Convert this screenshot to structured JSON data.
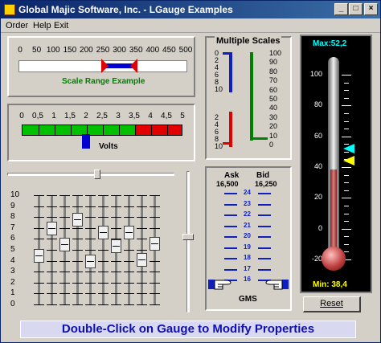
{
  "window": {
    "title": "Global Majic Software, Inc.  -  LGauge Examples"
  },
  "menu": {
    "items": [
      "Order",
      "Help",
      "Exit"
    ]
  },
  "scale_range": {
    "labels": [
      "0",
      "50",
      "100",
      "150",
      "200",
      "250",
      "300",
      "350",
      "400",
      "450",
      "500"
    ],
    "caption": "Scale Range Example",
    "range_low": 250,
    "range_high": 350
  },
  "volts": {
    "labels": [
      "0",
      "0,5",
      "1",
      "1,5",
      "2",
      "2,5",
      "3",
      "3,5",
      "4",
      "4,5",
      "5"
    ],
    "caption": "Volts",
    "value": 2,
    "green_max": 3.5,
    "colors": {
      "green": "#00c000",
      "red": "#e00000",
      "pointer": "#0000d0"
    }
  },
  "multiple_scales": {
    "title": "Multiple Scales",
    "left_top": [
      "0",
      "2",
      "4",
      "6",
      "8",
      "10"
    ],
    "left_bottom": [
      "2",
      "4",
      "6",
      "8",
      "10"
    ],
    "right": [
      "100",
      "90",
      "80",
      "70",
      "60",
      "50",
      "40",
      "30",
      "20",
      "10",
      "0"
    ]
  },
  "ask_bid": {
    "ask_label": "Ask",
    "bid_label": "Bid",
    "ask_value": "16,500",
    "bid_value": "16,250",
    "scale": [
      "24",
      "23",
      "22",
      "21",
      "20",
      "19",
      "18",
      "17",
      "16"
    ],
    "footer": "GMS",
    "colors": {
      "ask": "#008000",
      "bid": "#e00000"
    }
  },
  "faders": {
    "scale": [
      "10",
      "9",
      "8",
      "7",
      "6",
      "5",
      "4",
      "3",
      "2",
      "1",
      "0"
    ],
    "values": [
      4.5,
      7.0,
      5.5,
      7.8,
      4.0,
      6.6,
      5.4,
      6.6,
      4.1,
      5.6
    ]
  },
  "thermometer": {
    "max_label": "Max:52,2",
    "min_label": "Min: 38,4",
    "scale": [
      "100",
      "80",
      "60",
      "40",
      "20",
      "0",
      "-20"
    ],
    "value": 38.4,
    "marker_cyan": 52.2,
    "marker_yellow": 44,
    "colors": {
      "max": "#00ffff",
      "min": "#ffff00",
      "mercury": "#c04040"
    }
  },
  "buttons": {
    "reset": "Reset"
  },
  "status_message": "Double-Click on Gauge to Modify Properties"
}
